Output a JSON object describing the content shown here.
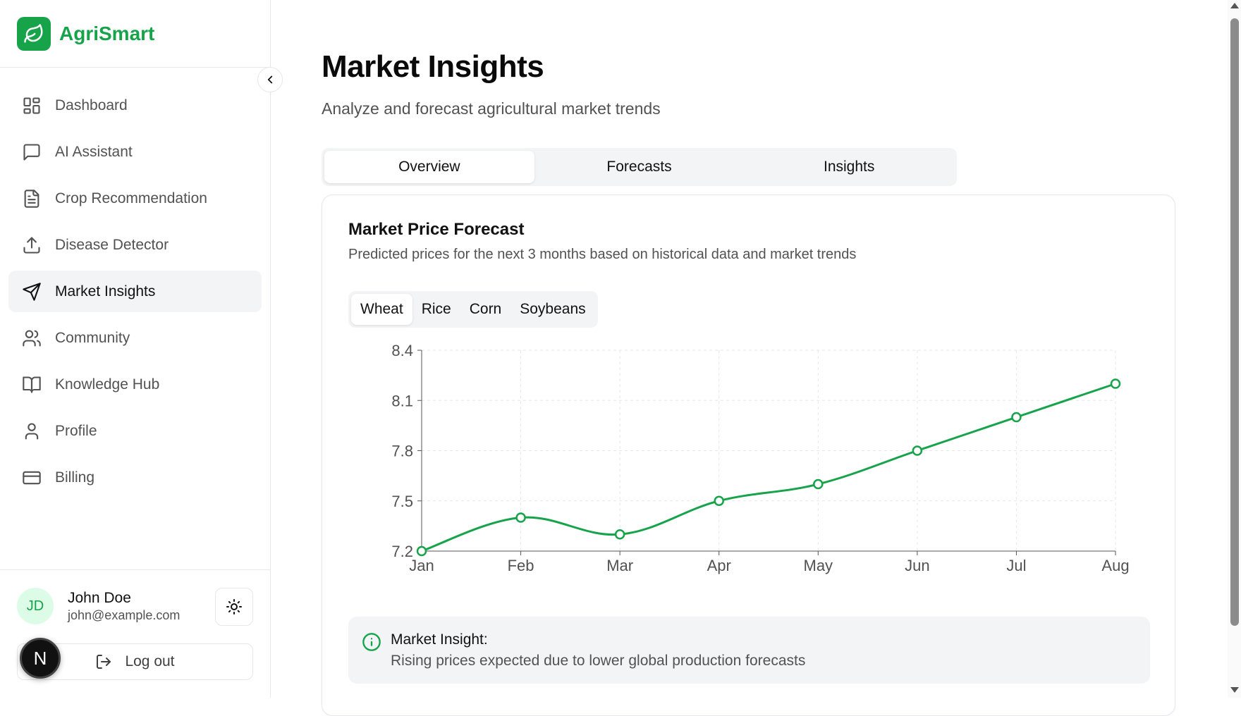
{
  "brand": {
    "name": "AgriSmart"
  },
  "sidebar": {
    "items": [
      {
        "label": "Dashboard",
        "icon": "dashboard-icon",
        "active": false
      },
      {
        "label": "AI Assistant",
        "icon": "message-square-icon",
        "active": false
      },
      {
        "label": "Crop Recommendation",
        "icon": "file-text-icon",
        "active": false
      },
      {
        "label": "Disease Detector",
        "icon": "upload-icon",
        "active": false
      },
      {
        "label": "Market Insights",
        "icon": "send-icon",
        "active": true
      },
      {
        "label": "Community",
        "icon": "users-icon",
        "active": false
      },
      {
        "label": "Knowledge Hub",
        "icon": "book-open-icon",
        "active": false
      },
      {
        "label": "Profile",
        "icon": "user-icon",
        "active": false
      },
      {
        "label": "Billing",
        "icon": "credit-card-icon",
        "active": false
      }
    ]
  },
  "user": {
    "initials": "JD",
    "name": "John Doe",
    "email": "john@example.com",
    "logout_label": "Log out"
  },
  "dev_badge": "N",
  "page": {
    "title": "Market Insights",
    "subtitle": "Analyze and forecast agricultural market trends"
  },
  "tabs": [
    {
      "label": "Overview",
      "active": true
    },
    {
      "label": "Forecasts",
      "active": false
    },
    {
      "label": "Insights",
      "active": false
    }
  ],
  "card": {
    "title": "Market Price Forecast",
    "description": "Predicted prices for the next 3 months based on historical data and market trends"
  },
  "crop_tabs": [
    {
      "label": "Wheat",
      "active": true
    },
    {
      "label": "Rice",
      "active": false
    },
    {
      "label": "Corn",
      "active": false
    },
    {
      "label": "Soybeans",
      "active": false
    }
  ],
  "chart_data": {
    "type": "line",
    "categories": [
      "Jan",
      "Feb",
      "Mar",
      "Apr",
      "May",
      "Jun",
      "Jul",
      "Aug"
    ],
    "series": [
      {
        "values": [
          7.2,
          7.4,
          7.3,
          7.5,
          7.6,
          7.8,
          8.0,
          8.2
        ]
      }
    ],
    "yticks": [
      "7.2",
      "7.5",
      "7.8",
      "8.1",
      "8.4"
    ],
    "ylim": [
      7.2,
      8.4
    ],
    "grid": true,
    "color": "#16a34a"
  },
  "insight": {
    "title": "Market Insight:",
    "text": "Rising prices expected due to lower global production forecasts"
  }
}
